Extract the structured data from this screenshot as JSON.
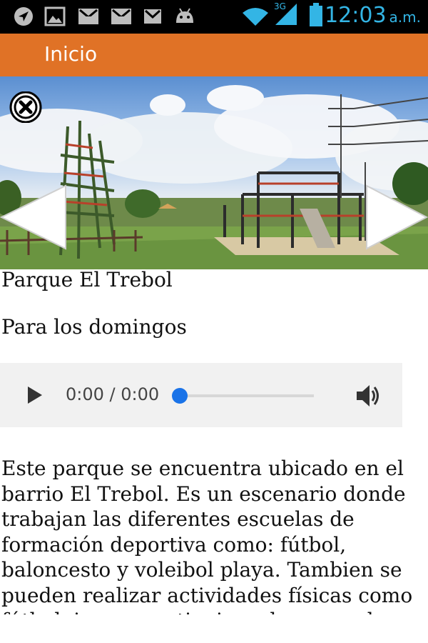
{
  "status_bar": {
    "time": "12:03",
    "ampm": "a.m.",
    "network": "3G",
    "icons": [
      "navigation-icon",
      "image-icon",
      "gmail-icon",
      "gmail-icon",
      "gmail-icon",
      "android-icon",
      "wifi-icon",
      "signal-icon",
      "battery-icon"
    ]
  },
  "header": {
    "title": "Inicio",
    "color": "#e07226"
  },
  "place": {
    "title": "Parque El Trebol",
    "subtitle": "Para los domingos",
    "description": "Este parque se encuentra ubicado en el barrio El Trebol. Es un escenario donde trabajan las diferentes escuelas de formación deportiva como: fútbol, baloncesto y voleibol playa. Tambien se pueden realizar actividades físicas como fútbol, juegos, patinaje y el parque de"
  },
  "audio": {
    "time": "0:00 / 0:00",
    "progress": 0,
    "accent": "#1a73e8"
  }
}
